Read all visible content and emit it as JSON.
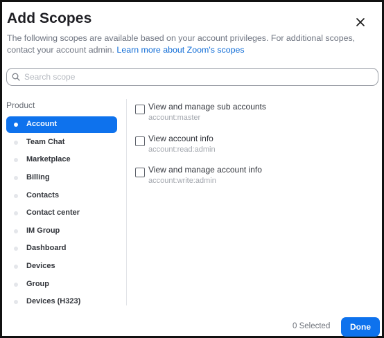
{
  "dialog": {
    "title": "Add Scopes",
    "description": "The following scopes are available based on your account privileges. For additional scopes, contact your account admin.",
    "learn_more": "Learn more about Zoom's scopes"
  },
  "search": {
    "placeholder": "Search scope",
    "value": ""
  },
  "sidebar": {
    "heading": "Product",
    "items": [
      {
        "label": "Account",
        "active": true
      },
      {
        "label": "Team Chat"
      },
      {
        "label": "Marketplace"
      },
      {
        "label": "Billing"
      },
      {
        "label": "Contacts"
      },
      {
        "label": "Contact center"
      },
      {
        "label": "IM Group"
      },
      {
        "label": "Dashboard"
      },
      {
        "label": "Devices"
      },
      {
        "label": "Group"
      },
      {
        "label": "Devices (H323)"
      }
    ]
  },
  "scopes": [
    {
      "name": "View and manage sub accounts",
      "code": "account:master",
      "checked": false
    },
    {
      "name": "View account info",
      "code": "account:read:admin",
      "checked": false
    },
    {
      "name": "View and manage account info",
      "code": "account:write:admin",
      "checked": false
    }
  ],
  "footer": {
    "selected": "0 Selected",
    "done": "Done"
  },
  "colors": {
    "accent": "#0e72ed",
    "link": "#0e6bd6"
  }
}
